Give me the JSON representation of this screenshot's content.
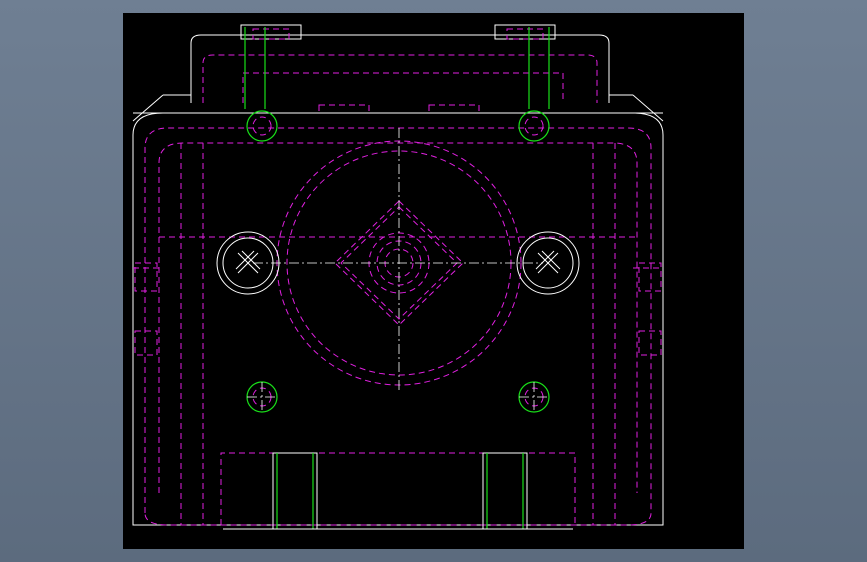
{
  "colors": {
    "background": "#5f6f83",
    "canvas": "#000000",
    "outline": "#ffffff",
    "hidden_lines": "#e020e0",
    "holes": "#19e019"
  },
  "drawing": {
    "view": "front",
    "line_styles": [
      "solid",
      "dashed",
      "center"
    ],
    "features": [
      "mounting-block",
      "top-plate",
      "large-bore",
      "square-boss",
      "cross-screws",
      "dowel-holes",
      "bottom-slots"
    ]
  }
}
